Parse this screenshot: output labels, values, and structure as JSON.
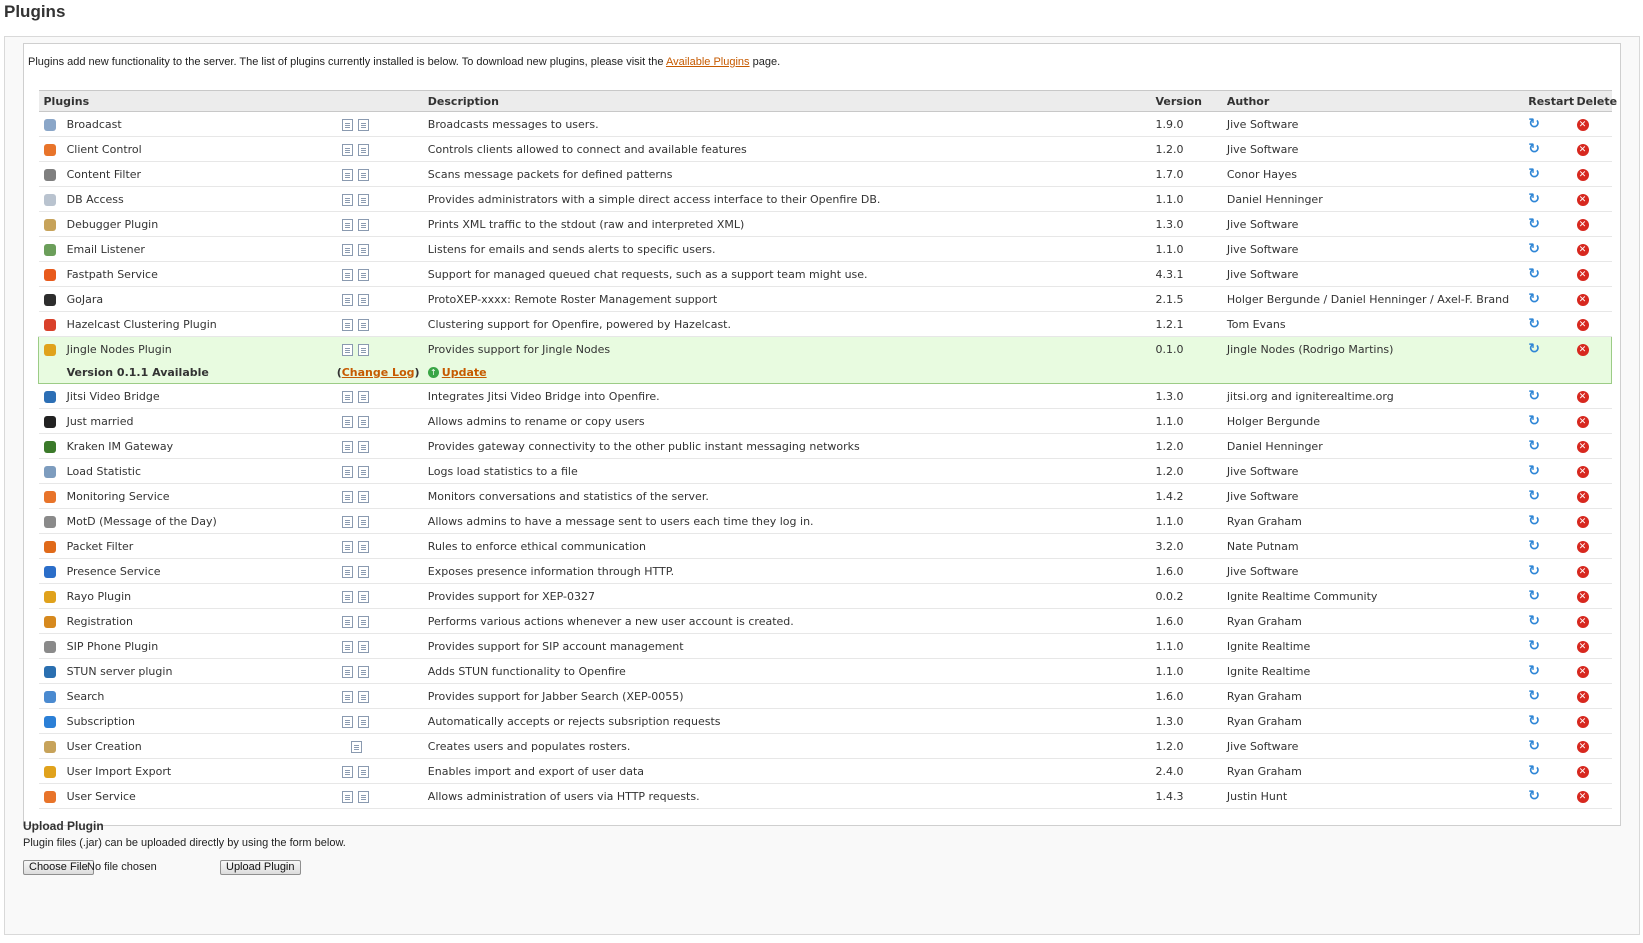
{
  "page_title": "Plugins",
  "intro": {
    "text_before": "Plugins add new functionality to the server. The list of plugins currently installed is below. To download new plugins, please visit the ",
    "link": "Available Plugins",
    "text_after": " page."
  },
  "columns": {
    "plugins": "Plugins",
    "description": "Description",
    "version": "Version",
    "author": "Author",
    "restart": "Restart",
    "delete": "Delete"
  },
  "plugins": [
    {
      "name": "Broadcast",
      "description": "Broadcasts messages to users.",
      "version": "1.9.0",
      "author": "Jive Software",
      "icon": "broadcast-icon",
      "icon_color": "#8aa6c8"
    },
    {
      "name": "Client Control",
      "description": "Controls clients allowed to connect and available features",
      "version": "1.2.0",
      "author": "Jive Software",
      "icon": "client-control-icon",
      "icon_color": "#e8742a"
    },
    {
      "name": "Content Filter",
      "description": "Scans message packets for defined patterns",
      "version": "1.7.0",
      "author": "Conor Hayes",
      "icon": "filter-icon",
      "icon_color": "#7f7f7f"
    },
    {
      "name": "DB Access",
      "description": "Provides administrators with a simple direct access interface to their Openfire DB.",
      "version": "1.1.0",
      "author": "Daniel Henninger",
      "icon": "db-icon",
      "icon_color": "#b9c3cf"
    },
    {
      "name": "Debugger Plugin",
      "description": "Prints XML traffic to the stdout (raw and interpreted XML)",
      "version": "1.3.0",
      "author": "Jive Software",
      "icon": "debugger-icon",
      "icon_color": "#c7a35a"
    },
    {
      "name": "Email Listener",
      "description": "Listens for emails and sends alerts to specific users.",
      "version": "1.1.0",
      "author": "Jive Software",
      "icon": "email-icon",
      "icon_color": "#6b9e5a"
    },
    {
      "name": "Fastpath Service",
      "description": "Support for managed queued chat requests, such as a support team might use.",
      "version": "4.3.1",
      "author": "Jive Software",
      "icon": "fastpath-icon",
      "icon_color": "#e85a1c"
    },
    {
      "name": "GoJara",
      "description": "ProtoXEP-xxxx: Remote Roster Management support",
      "version": "2.1.5",
      "author": "Holger Bergunde / Daniel Henninger / Axel-F. Brand",
      "icon": "gojara-icon",
      "icon_color": "#2d2d2d"
    },
    {
      "name": "Hazelcast Clustering Plugin",
      "description": "Clustering support for Openfire, powered by Hazelcast.",
      "version": "1.2.1",
      "author": "Tom Evans",
      "icon": "hazelcast-icon",
      "icon_color": "#d9412b"
    },
    {
      "name": "Jingle Nodes Plugin",
      "description": "Provides support for Jingle Nodes",
      "version": "0.1.0",
      "author": "Jingle Nodes (Rodrigo Martins)",
      "icon": "jingle-icon",
      "icon_color": "#e0a21c",
      "update": {
        "available": "Version 0.1.1 Available",
        "changelog": "Change Log",
        "update": "Update",
        "paren_open": "(",
        "paren_close": ")"
      }
    },
    {
      "name": "Jitsi Video Bridge",
      "description": "Integrates Jitsi Video Bridge into Openfire.",
      "version": "1.3.0",
      "author": "jitsi.org and igniterealtime.org",
      "icon": "jitsi-icon",
      "icon_color": "#2c6fb5"
    },
    {
      "name": "Just married",
      "description": "Allows admins to rename or copy users",
      "version": "1.1.0",
      "author": "Holger Bergunde",
      "icon": "married-icon",
      "icon_color": "#222222"
    },
    {
      "name": "Kraken IM Gateway",
      "description": "Provides gateway connectivity to the other public instant messaging networks",
      "version": "1.2.0",
      "author": "Daniel Henninger",
      "icon": "kraken-icon",
      "icon_color": "#3b7a2a"
    },
    {
      "name": "Load Statistic",
      "description": "Logs load statistics to a file",
      "version": "1.2.0",
      "author": "Jive Software",
      "icon": "chart-icon",
      "icon_color": "#7d9cbe"
    },
    {
      "name": "Monitoring Service",
      "description": "Monitors conversations and statistics of the server.",
      "version": "1.4.2",
      "author": "Jive Software",
      "icon": "monitoring-icon",
      "icon_color": "#e8742a"
    },
    {
      "name": "MotD (Message of the Day)",
      "description": "Allows admins to have a message sent to users each time they log in.",
      "version": "1.1.0",
      "author": "Ryan Graham",
      "icon": "motd-icon",
      "icon_color": "#8a8a8a"
    },
    {
      "name": "Packet Filter",
      "description": "Rules to enforce ethical communication",
      "version": "3.2.0",
      "author": "Nate Putnam",
      "icon": "packet-filter-icon",
      "icon_color": "#e06a1a"
    },
    {
      "name": "Presence Service",
      "description": "Exposes presence information through HTTP.",
      "version": "1.6.0",
      "author": "Jive Software",
      "icon": "presence-icon",
      "icon_color": "#2b6ec9"
    },
    {
      "name": "Rayo Plugin",
      "description": "Provides support for XEP-0327",
      "version": "0.0.2",
      "author": "Ignite Realtime Community",
      "icon": "rayo-icon",
      "icon_color": "#e0a21c"
    },
    {
      "name": "Registration",
      "description": "Performs various actions whenever a new user account is created.",
      "version": "1.6.0",
      "author": "Ryan Graham",
      "icon": "registration-icon",
      "icon_color": "#d6891e"
    },
    {
      "name": "SIP Phone Plugin",
      "description": "Provides support for SIP account management",
      "version": "1.1.0",
      "author": "Ignite Realtime",
      "icon": "sip-icon",
      "icon_color": "#8a8a8a"
    },
    {
      "name": "STUN server plugin",
      "description": "Adds STUN functionality to Openfire",
      "version": "1.1.0",
      "author": "Ignite Realtime",
      "icon": "stun-icon",
      "icon_color": "#2a6fb0"
    },
    {
      "name": "Search",
      "description": "Provides support for Jabber Search (XEP-0055)",
      "version": "1.6.0",
      "author": "Ryan Graham",
      "icon": "search-icon",
      "icon_color": "#4a8ad0"
    },
    {
      "name": "Subscription",
      "description": "Automatically accepts or rejects subsription requests",
      "version": "1.3.0",
      "author": "Ryan Graham",
      "icon": "subscription-icon",
      "icon_color": "#2b7fd6"
    },
    {
      "name": "User Creation",
      "description": "Creates users and populates rosters.",
      "version": "1.2.0",
      "author": "Jive Software",
      "icon": "user-creation-icon",
      "icon_color": "#c7a35a",
      "docs_count": 1
    },
    {
      "name": "User Import Export",
      "description": "Enables import and export of user data",
      "version": "2.4.0",
      "author": "Ryan Graham",
      "icon": "import-export-icon",
      "icon_color": "#e0a21c"
    },
    {
      "name": "User Service",
      "description": "Allows administration of users via HTTP requests.",
      "version": "1.4.3",
      "author": "Justin Hunt",
      "icon": "user-service-icon",
      "icon_color": "#e8742a"
    }
  ],
  "upload": {
    "title": "Upload Plugin",
    "description": "Plugin files (.jar) can be uploaded directly by using the form below.",
    "choose_file": "Choose File",
    "no_file": "No file chosen",
    "upload_button": "Upload Plugin"
  },
  "icons": {
    "restart": "↻",
    "delete": "✕",
    "update": "↑"
  }
}
